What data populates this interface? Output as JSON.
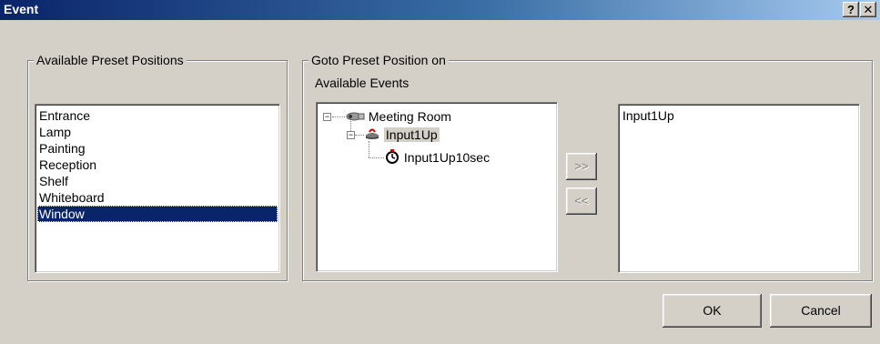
{
  "window": {
    "title": "Event",
    "help_label": "?",
    "close_label": "✕"
  },
  "preset_group": {
    "legend": "Available Preset Positions",
    "items": [
      "Entrance",
      "Lamp",
      "Painting",
      "Reception",
      "Shelf",
      "Whiteboard",
      "Window"
    ],
    "selected": "Window"
  },
  "goto_group": {
    "legend": "Goto Preset Position on",
    "events_label": "Available Events",
    "tree": {
      "root": {
        "label": "Meeting Room",
        "icon": "camera-icon",
        "expander": "−"
      },
      "child": {
        "label": "Input1Up",
        "icon": "input-sensor-icon",
        "expander": "−",
        "selected": true
      },
      "grandchild": {
        "label": "Input1Up10sec",
        "icon": "timer-icon"
      }
    },
    "add_label": ">>",
    "remove_label": "<<",
    "assigned": [
      "Input1Up"
    ]
  },
  "footer": {
    "ok_label": "OK",
    "cancel_label": "Cancel"
  }
}
